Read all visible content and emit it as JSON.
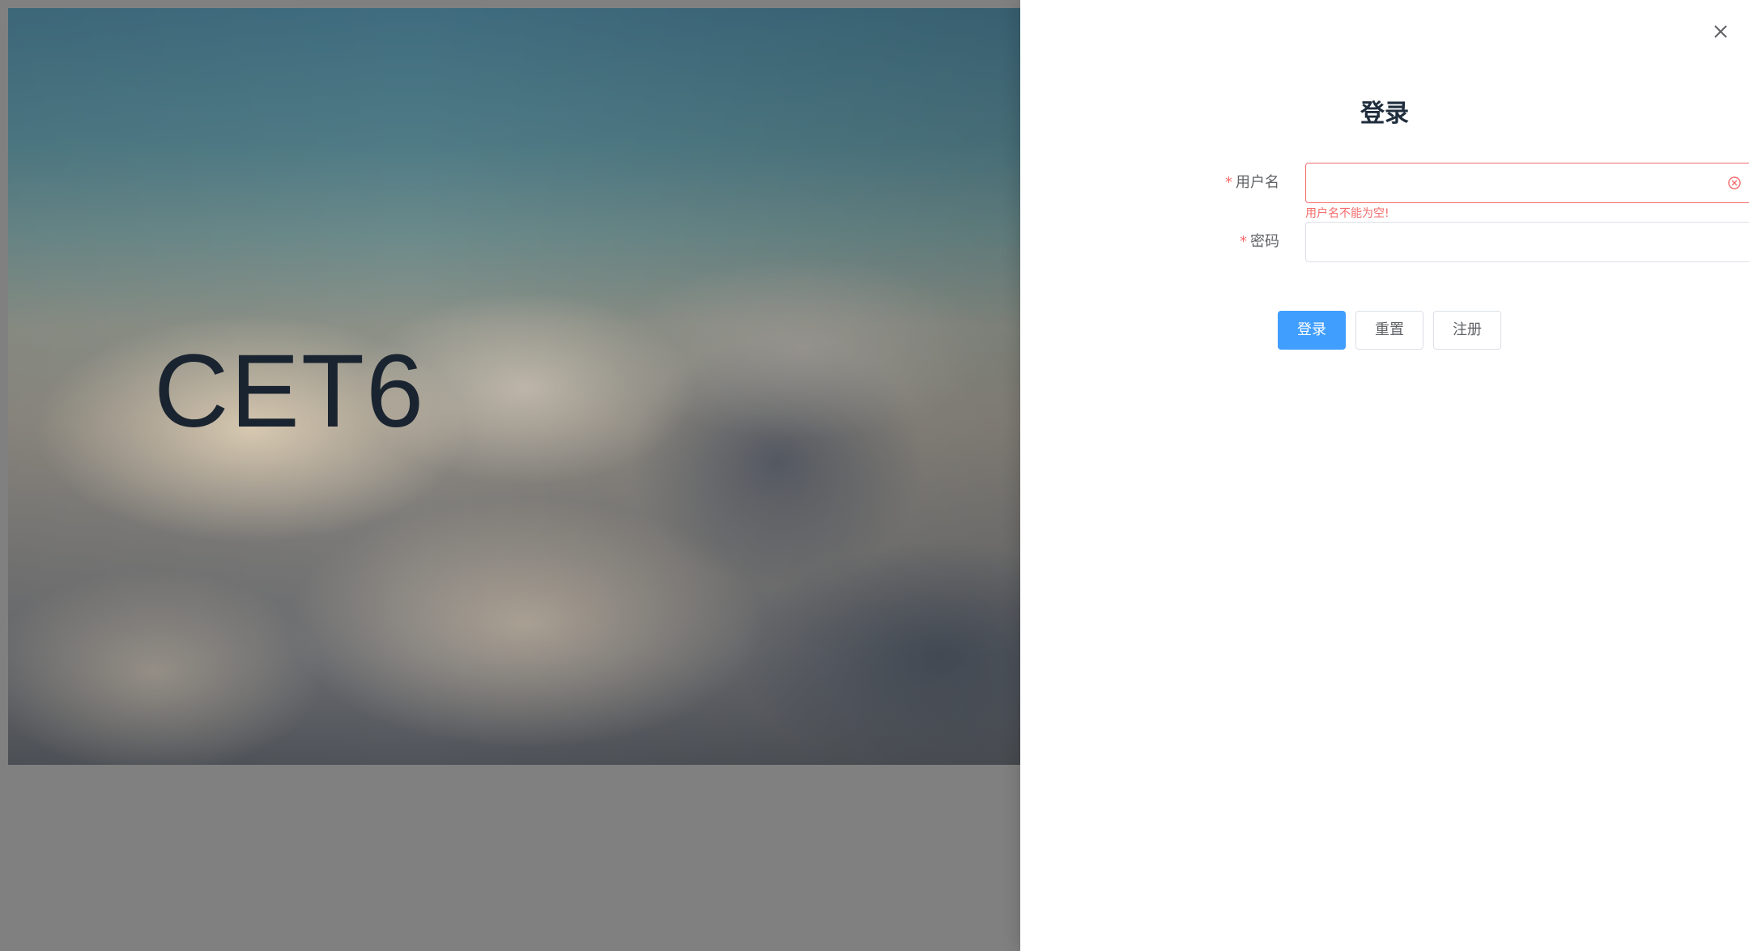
{
  "hero": {
    "title": "CET6"
  },
  "drawer": {
    "title": "登录",
    "close_icon": "close-icon",
    "form": {
      "username": {
        "label": "用户名",
        "required_mark": "*",
        "value": "",
        "error": "用户名不能为空!",
        "clear_icon": "circle-close-icon"
      },
      "password": {
        "label": "密码",
        "required_mark": "*",
        "value": ""
      }
    },
    "buttons": {
      "login": "登录",
      "reset": "重置",
      "register": "注册"
    }
  },
  "colors": {
    "primary": "#409eff",
    "error": "#f56c6c",
    "title": "#1f2d3d",
    "label": "#606266",
    "overlay": "#808080"
  }
}
